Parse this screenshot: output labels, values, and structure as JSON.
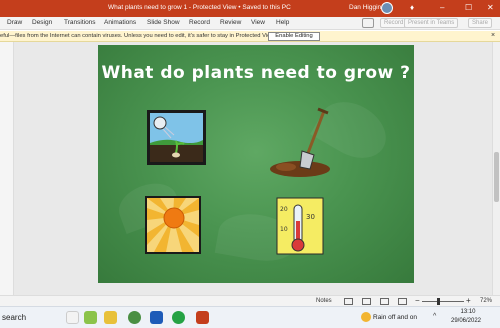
{
  "window": {
    "title": "What plants need to grow 1  -  Protected View • Saved to this PC",
    "user_name": "Dan Higgins",
    "title_bg": "#c43e1c"
  },
  "ribbon": {
    "tabs": [
      "Draw",
      "Design",
      "Transitions",
      "Animations",
      "Slide Show",
      "Record",
      "Review",
      "View",
      "Help"
    ],
    "record_button": "Record",
    "present_button": "Present in Teams",
    "share_button": "Share"
  },
  "protected_view": {
    "message": "eful—files from the Internet can contain viruses. Unless you need to edit, it's safer to stay in Protected View.",
    "enable_button": "Enable Editing"
  },
  "slide": {
    "title": "What do plants need to grow ?",
    "background": "#4a9450",
    "pictures": [
      {
        "name": "watering-can-seedling",
        "icon": "watering-can-icon"
      },
      {
        "name": "spade-in-soil",
        "icon": "spade-icon"
      },
      {
        "name": "sun",
        "icon": "sun-icon"
      },
      {
        "name": "thermometer",
        "icon": "thermometer-icon"
      }
    ],
    "thermometer_labels": [
      "20",
      "30",
      "10"
    ]
  },
  "statusbar": {
    "notes_label": "Notes",
    "zoom_percent": "72%",
    "zoom_minus": "−",
    "zoom_plus": "+"
  },
  "taskbar": {
    "search_label": "search",
    "weather_text": "Rain off and on",
    "time": "13:10",
    "date": "29/06/2022"
  }
}
